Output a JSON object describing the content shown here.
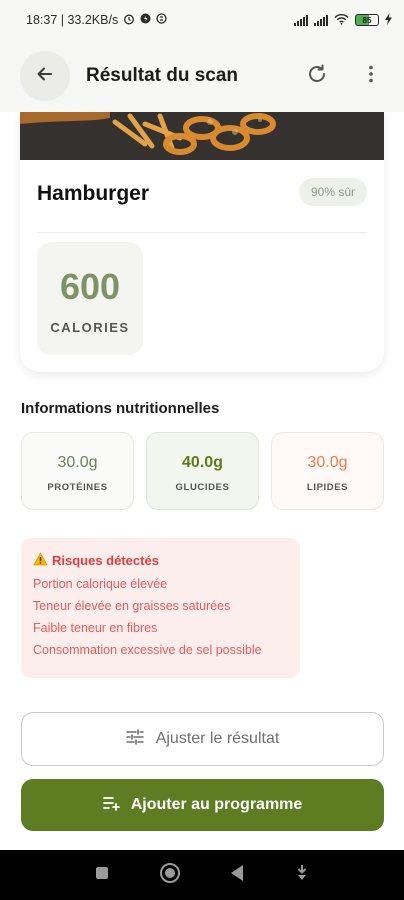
{
  "status_bar": {
    "time_info": "18:37 | 33.2KB/s",
    "battery": "85"
  },
  "app_bar": {
    "title": "Résultat du scan",
    "icons": [
      "back-arrow-icon",
      "refresh-icon",
      "more-vertical-icon"
    ]
  },
  "result": {
    "food_name": "Hamburger",
    "confidence": "90% sûr",
    "calories_value": "600",
    "calories_label": "CALORIES"
  },
  "nutrition": {
    "title": "Informations nutritionnelles",
    "macros": [
      {
        "value": "30.0g",
        "label": "PROTÉINES"
      },
      {
        "value": "40.0g",
        "label": "GLUCIDES"
      },
      {
        "value": "30.0g",
        "label": "LIPIDES"
      }
    ]
  },
  "risks": {
    "title": "Risques détectés",
    "items": [
      "Portion calorique élevée",
      "Teneur élevée en graisses saturées",
      "Faible teneur en fibres",
      "Consommation excessive de sel possible"
    ]
  },
  "actions": {
    "adjust_label": "Ajuster le résultat",
    "add_label": "Ajouter au programme"
  },
  "colors": {
    "primary": "#5e7c22",
    "calories": "#7f9369",
    "risk_text": "#e23b3b",
    "risk_bg": "#fdeeee",
    "lipides": "#f07a4d"
  }
}
